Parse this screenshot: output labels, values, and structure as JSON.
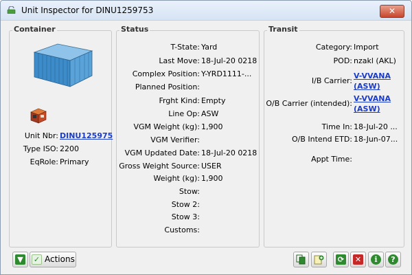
{
  "window": {
    "title": "Unit Inspector for DINU1259753",
    "close_label": "✕"
  },
  "container": {
    "heading": "Container",
    "fields": [
      {
        "label": "Unit Nbr:",
        "value": "DINU125975"
      },
      {
        "label": "Type ISO:",
        "value": "2200"
      },
      {
        "label": "EqRole:",
        "value": "Primary"
      }
    ]
  },
  "status": {
    "heading": "Status",
    "fields": [
      {
        "label": "T-State:",
        "value": "Yard"
      },
      {
        "label": "Last Move:",
        "value": "18-Jul-20 0218"
      },
      {
        "label": "Complex Position:",
        "value": "Y-YRD1111-..."
      },
      {
        "label": "Planned Position:",
        "value": ""
      },
      {
        "label": "Frght Kind:",
        "value": "Empty"
      },
      {
        "label": "Line Op:",
        "value": "ASW"
      },
      {
        "label": "VGM Weight (kg):",
        "value": "1,900"
      },
      {
        "label": "VGM Verifier:",
        "value": ""
      },
      {
        "label": "VGM Updated Date:",
        "value": "18-Jul-20 0218"
      },
      {
        "label": "Gross Weight Source:",
        "value": "USER"
      },
      {
        "label": "Weight (kg):",
        "value": "1,900"
      },
      {
        "label": "Stow:",
        "value": ""
      },
      {
        "label": "Stow 2:",
        "value": ""
      },
      {
        "label": "Stow 3:",
        "value": ""
      },
      {
        "label": "Customs:",
        "value": ""
      }
    ]
  },
  "transit": {
    "heading": "Transit",
    "category": {
      "label": "Category:",
      "value": "Import"
    },
    "pod": {
      "label": "POD:",
      "value": "nzakl (AKL)"
    },
    "ib_carrier": {
      "label": "I/B Carrier:",
      "line1": "V-VVANA",
      "line2": "(ASW)"
    },
    "ob_carrier": {
      "label": "O/B Carrier (intended):",
      "line1": "V-VVANA",
      "line2": "(ASW)"
    },
    "time_in": {
      "label": "Time In:",
      "value": "18-Jul-20 ..."
    },
    "ob_etd": {
      "label": "O/B Intend ETD:",
      "value": "18-Jun-07..."
    },
    "appt_time": {
      "label": "Appt Time:",
      "value": ""
    }
  },
  "toolbar": {
    "actions_label": "Actions"
  },
  "colors": {
    "accent_link": "#1a3cc8",
    "ok_green": "#2f8a2f",
    "error_red": "#c62828"
  }
}
